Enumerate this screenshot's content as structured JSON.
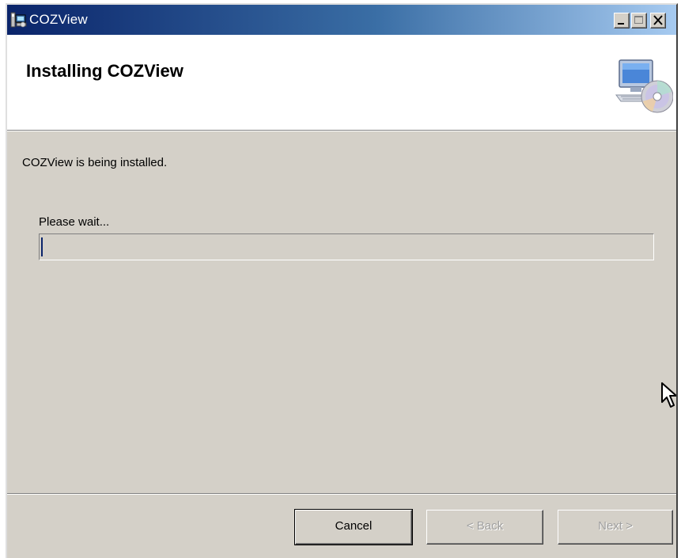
{
  "window": {
    "title": "COZView"
  },
  "header": {
    "title": "Installing COZView",
    "icon": "computer-with-cd-icon"
  },
  "main": {
    "status_text": "COZView is being installed.",
    "wait_text": "Please wait...",
    "progress": 0.0
  },
  "buttons": {
    "cancel": "Cancel",
    "back": "< Back",
    "next": "Next >"
  },
  "colors": {
    "titlebar_start": "#0a246a",
    "titlebar_end": "#a6caf0",
    "dialog_bg": "#d4d0c8",
    "disabled_text": "#a0a0a0"
  }
}
